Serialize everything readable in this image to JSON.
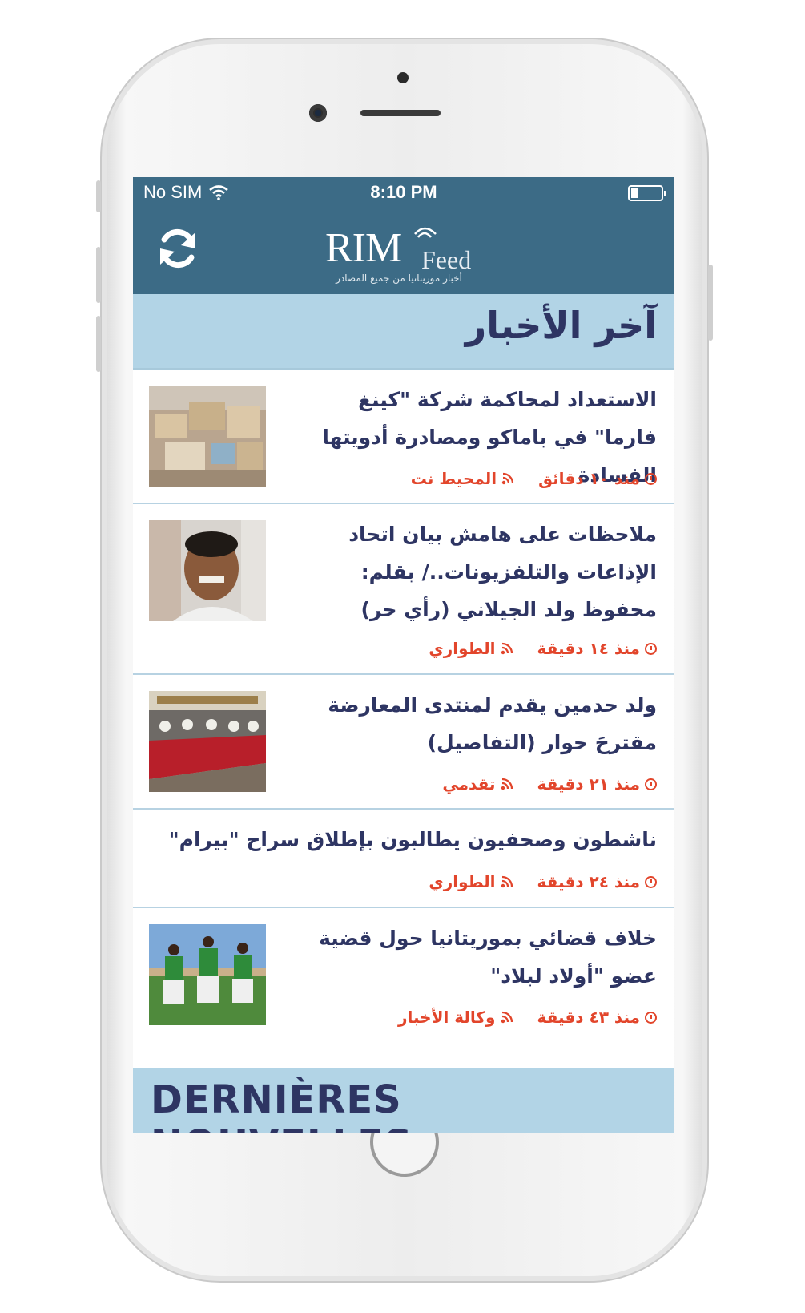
{
  "status": {
    "carrier": "No SIM",
    "time": "8:10 PM",
    "battery_level": 0.25
  },
  "header": {
    "refresh_icon": "refresh-icon",
    "logo_main": "RIM",
    "logo_sub": "Feed",
    "logo_tagline": "أخبار موريتانيا من جميع المصادر"
  },
  "section_ar": {
    "title": "آخر الأخبار"
  },
  "news": [
    {
      "title": "الاستعداد لمحاكمة شركة \"كينغ فارما\" في باماكو ومصادرة أدويتها الفسادة",
      "time": "منذ ١٠ دقائق",
      "source": "المحيط نت",
      "has_image": true,
      "image": "boxes-photo"
    },
    {
      "title": "ملاحظات على هامش بيان اتحاد الإذاعات والتلفزيونات../ بقلم: محفوظ ولد الجيلاني (رأي حر)",
      "time": "منذ ١٤ دقيقة",
      "source": "الطواري",
      "has_image": true,
      "image": "portrait-photo"
    },
    {
      "title": "ولد حدمين يقدم لمنتدى المعارضة مقترحَ حوار (التفاصيل)",
      "time": "منذ ٢١ دقيقة",
      "source": "تقدمي",
      "has_image": true,
      "image": "meeting-photo"
    },
    {
      "title": "ناشطون وصحفيون يطالبون بإطلاق سراح \"بيرام\"",
      "time": "منذ ٢٤ دقيقة",
      "source": "الطواري",
      "has_image": false
    },
    {
      "title": "خلاف قضائي بموريتانيا حول قضية عضو \"أولاد لبلاد\"",
      "time": "منذ ٤٣ دقيقة",
      "source": "وكالة الأخبار",
      "has_image": true,
      "image": "dancers-photo"
    }
  ],
  "section_fr": {
    "title": "DERNIÈRES NOUVELLES"
  },
  "colors": {
    "nav_bg": "#3c6b86",
    "section_bg": "#b2d4e6",
    "title_text": "#2e3563",
    "meta_text": "#e2452b"
  }
}
